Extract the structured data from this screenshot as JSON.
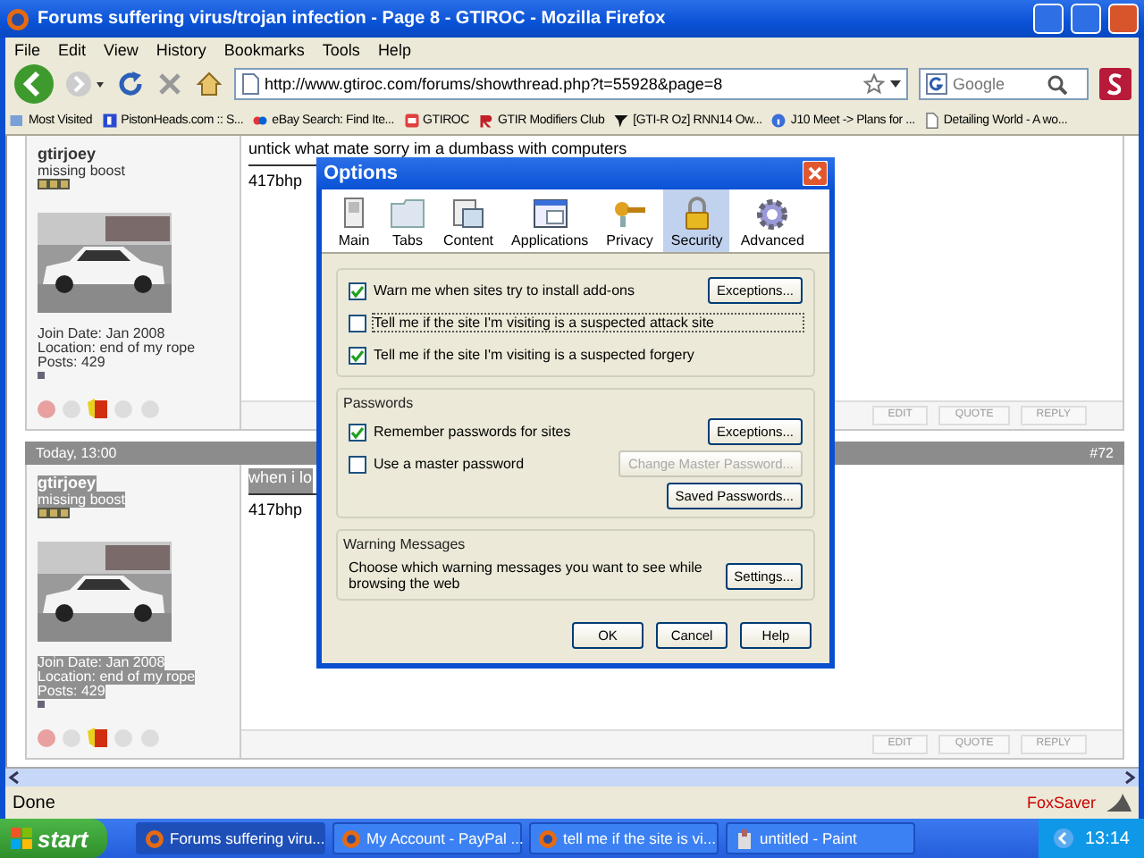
{
  "window": {
    "title": "Forums suffering virus/trojan infection - Page 8 - GTIROC - Mozilla Firefox"
  },
  "menu": [
    "File",
    "Edit",
    "View",
    "History",
    "Bookmarks",
    "Tools",
    "Help"
  ],
  "toolbar": {
    "url": "http://www.gtiroc.com/forums/showthread.php?t=55928&page=8",
    "search_placeholder": "Google"
  },
  "bookmarks": [
    {
      "kind": "star",
      "label": "Most Visited"
    },
    {
      "kind": "p",
      "label": "PistonHeads.com :: S..."
    },
    {
      "kind": "ebay",
      "label": "eBay Search: Find Ite..."
    },
    {
      "kind": "box",
      "label": "GTIROC"
    },
    {
      "kind": "r",
      "label": "GTIR Modifiers Club"
    },
    {
      "kind": "logo",
      "label": "[GTI-R Oz] RNN14 Ow..."
    },
    {
      "kind": "info",
      "label": "J10 Meet -> Plans for ..."
    },
    {
      "kind": "page",
      "label": "Detailing World - A wo..."
    }
  ],
  "posts": [
    {
      "highlighted": false,
      "username": "gtirjoey",
      "usertitle": "missing boost",
      "join": "Join Date: Jan 2008",
      "location": "Location: end of my rope",
      "count": "Posts: 429",
      "lines": [
        "untick what mate sorry im a dumbass with computers",
        "417bhp"
      ],
      "actions": [
        "EDIT",
        "QUOTE",
        "REPLY"
      ]
    },
    {
      "header": {
        "date": "Today, 13:00",
        "number": "#72"
      },
      "highlighted": true,
      "username": "gtirjoey",
      "usertitle": "missing boost",
      "join": "Join Date: Jan 2008",
      "location": "Location: end of my rope",
      "count": "Posts: 429",
      "lines": [
        "when i lo",
        "417bhp"
      ],
      "actions": [
        "EDIT",
        "QUOTE",
        "REPLY"
      ]
    }
  ],
  "dialog": {
    "title": "Options",
    "tabs": [
      {
        "kind": "main",
        "label": "Main",
        "selected": false
      },
      {
        "kind": "tabs",
        "label": "Tabs",
        "selected": false
      },
      {
        "kind": "content",
        "label": "Content",
        "selected": false
      },
      {
        "kind": "applications",
        "label": "Applications",
        "selected": false
      },
      {
        "kind": "privacy",
        "label": "Privacy",
        "selected": false
      },
      {
        "kind": "security",
        "label": "Security",
        "selected": true
      },
      {
        "kind": "advanced",
        "label": "Advanced",
        "selected": false
      }
    ],
    "security": [
      {
        "label": "Warn me when sites try to install add-ons",
        "checked": true,
        "button": {
          "label": "Exceptions...",
          "disabled": false
        }
      },
      {
        "label": "Tell me if the site I'm visiting is a suspected attack site",
        "checked": false
      },
      {
        "label": "Tell me if the site I'm visiting is a suspected forgery",
        "checked": true
      }
    ],
    "passwords": {
      "title": "Passwords",
      "items": [
        {
          "label": "Remember passwords for sites",
          "checked": true,
          "button": {
            "label": "Exceptions...",
            "disabled": false
          }
        },
        {
          "label": "Use a master password",
          "checked": false,
          "button": {
            "label": "Change Master Password...",
            "disabled": true
          }
        }
      ],
      "saved": "Saved Passwords..."
    },
    "warnings": {
      "title": "Warning Messages",
      "text": "Choose which warning messages you want to see while browsing the web",
      "button": "Settings..."
    },
    "buttons": [
      "OK",
      "Cancel",
      "Help"
    ]
  },
  "status": {
    "text": "Done",
    "addon": "FoxSaver"
  },
  "taskbar": {
    "start": "start",
    "tasks": [
      {
        "kind": "firefox",
        "label": "Forums suffering viru...",
        "selected": true
      },
      {
        "kind": "firefox",
        "label": "My Account - PayPal ...",
        "selected": false
      },
      {
        "kind": "firefox",
        "label": "tell me if the site is vi...",
        "selected": false
      },
      {
        "kind": "paint",
        "label": "untitled - Paint",
        "selected": false
      }
    ],
    "clock": "13:14"
  }
}
